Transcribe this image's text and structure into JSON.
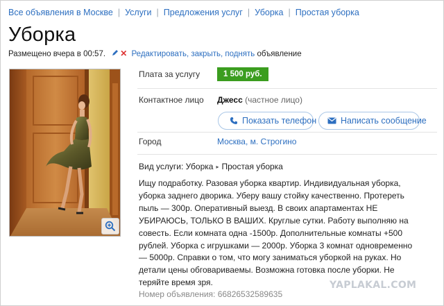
{
  "breadcrumb": {
    "items": [
      "Все объявления в Москве",
      "Услуги",
      "Предложения услуг",
      "Уборка",
      "Простая уборка"
    ]
  },
  "title": "Уборка",
  "meta": {
    "posted": "Размещено вчера в 00:57.",
    "actions": "Редактировать, закрыть, поднять",
    "suffix": "объявление"
  },
  "details": {
    "price_label": "Плата за услугу",
    "price_value": "1 500 руб.",
    "contact_label": "Контактное лицо",
    "contact_name": "Джесс",
    "contact_type": "(частное лицо)",
    "show_phone": "Показать телефон",
    "write_message": "Написать сообщение",
    "city_label": "Город",
    "city_value": "Москва, м. Строгино"
  },
  "service": {
    "label": "Вид услуги:",
    "category": "Уборка",
    "subcategory": "Простая уборка"
  },
  "description": "Ищу подработку. Разовая уборка квартир. Индивидуальная уборка, уборка заднего дворика. Уберу вашу стойку качественно. Протереть пыль — 300р. Оперативный выезд. В своих апартаментах НЕ УБИРАЮСЬ, ТОЛЬКО В ВАШИХ. Круглые сутки. Работу выполняю на совесть. Если комната одна -1500р. Дополнительные комнаты +500 рублей. Уборка с игрушками — 2000р. Уборка 3 комнат одновременно — 5000р. Справки о том, что могу заниматься уборкой на руках. Но детали цены обговариваемы. Возможна готовка после уборки. Не теряйте время зря.",
  "ad_number": "Номер объявления: 66826532589635",
  "watermark": "YAPLAKAL.COM",
  "colors": {
    "link": "#2d6fc0",
    "price_badge": "#3b9d1f",
    "delete_icon": "#dd3333"
  },
  "icons": {
    "edit": "pencil-icon",
    "delete": "close-icon",
    "phone": "phone-icon",
    "message": "envelope-icon",
    "zoom": "zoom-in-icon"
  }
}
